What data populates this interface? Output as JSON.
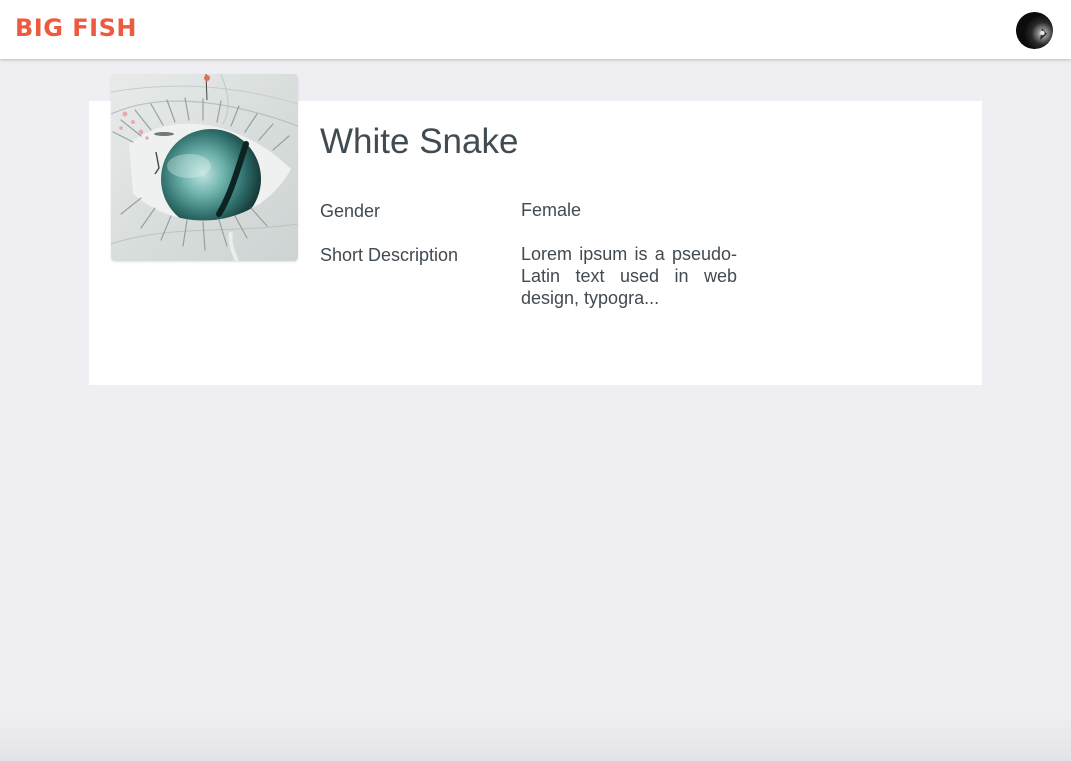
{
  "header": {
    "brand": "BIG FISH",
    "avatar_icon": "user-avatar-icon"
  },
  "profile": {
    "name": "White Snake",
    "photo_icon": "eye-artwork-image",
    "fields": {
      "gender_label": "Gender",
      "gender_value": "Female",
      "description_label": "Short Description",
      "description_value": "Lorem ipsum is a pseudo-Latin text used in web design, typogra..."
    }
  },
  "colors": {
    "brand": "#ec5a40",
    "text": "#424a51",
    "background": "#efeff3",
    "card": "#ffffff"
  }
}
